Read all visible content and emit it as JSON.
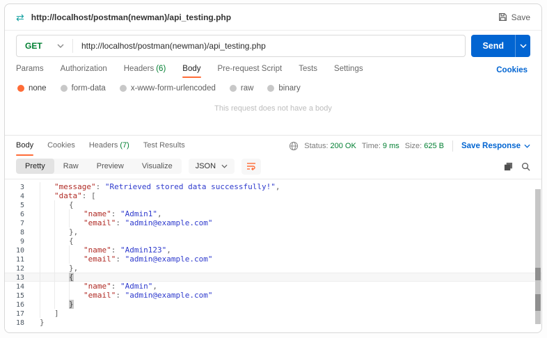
{
  "titlebar": {
    "title": "http://localhost/postman(newman)/api_testing.php",
    "save_label": "Save"
  },
  "request": {
    "method": "GET",
    "url": "http://localhost/postman(newman)/api_testing.php",
    "send_label": "Send",
    "tabs": [
      {
        "label": "Params"
      },
      {
        "label": "Authorization"
      },
      {
        "label": "Headers",
        "count": "(6)"
      },
      {
        "label": "Body",
        "active": true
      },
      {
        "label": "Pre-request Script"
      },
      {
        "label": "Tests"
      },
      {
        "label": "Settings"
      }
    ],
    "cookies_link": "Cookies",
    "body_types": [
      {
        "label": "none",
        "selected": true
      },
      {
        "label": "form-data"
      },
      {
        "label": "x-www-form-urlencoded"
      },
      {
        "label": "raw"
      },
      {
        "label": "binary"
      }
    ],
    "empty_body_message": "This request does not have a body"
  },
  "response": {
    "tabs": [
      {
        "label": "Body",
        "active": true
      },
      {
        "label": "Cookies"
      },
      {
        "label": "Headers",
        "count": "(7)"
      },
      {
        "label": "Test Results"
      }
    ],
    "meta": {
      "status_label": "Status:",
      "status_value": "200 OK",
      "time_label": "Time:",
      "time_value": "9 ms",
      "size_label": "Size:",
      "size_value": "625 B"
    },
    "save_response_label": "Save Response",
    "view_tabs": [
      {
        "label": "Pretty",
        "active": true
      },
      {
        "label": "Raw"
      },
      {
        "label": "Preview"
      },
      {
        "label": "Visualize"
      }
    ],
    "format_select": "JSON",
    "code": {
      "lines": [
        {
          "n": 3,
          "indent": 1,
          "tokens": [
            {
              "c": "key",
              "t": "\"message\""
            },
            {
              "c": "punc",
              "t": ": "
            },
            {
              "c": "str",
              "t": "\"Retrieved stored data successfully!\""
            },
            {
              "c": "punc",
              "t": ","
            }
          ]
        },
        {
          "n": 4,
          "indent": 1,
          "tokens": [
            {
              "c": "key",
              "t": "\"data\""
            },
            {
              "c": "punc",
              "t": ": "
            },
            {
              "c": "punc",
              "t": "["
            }
          ]
        },
        {
          "n": 5,
          "indent": 2,
          "tokens": [
            {
              "c": "punc",
              "t": "{"
            }
          ]
        },
        {
          "n": 6,
          "indent": 3,
          "tokens": [
            {
              "c": "key",
              "t": "\"name\""
            },
            {
              "c": "punc",
              "t": ": "
            },
            {
              "c": "str",
              "t": "\"Admin1\""
            },
            {
              "c": "punc",
              "t": ","
            }
          ]
        },
        {
          "n": 7,
          "indent": 3,
          "tokens": [
            {
              "c": "key",
              "t": "\"email\""
            },
            {
              "c": "punc",
              "t": ": "
            },
            {
              "c": "str",
              "t": "\"admin@example.com\""
            }
          ]
        },
        {
          "n": 8,
          "indent": 2,
          "tokens": [
            {
              "c": "punc",
              "t": "},"
            }
          ]
        },
        {
          "n": 9,
          "indent": 2,
          "tokens": [
            {
              "c": "punc",
              "t": "{"
            }
          ]
        },
        {
          "n": 10,
          "indent": 3,
          "tokens": [
            {
              "c": "key",
              "t": "\"name\""
            },
            {
              "c": "punc",
              "t": ": "
            },
            {
              "c": "str",
              "t": "\"Admin123\""
            },
            {
              "c": "punc",
              "t": ","
            }
          ]
        },
        {
          "n": 11,
          "indent": 3,
          "tokens": [
            {
              "c": "key",
              "t": "\"email\""
            },
            {
              "c": "punc",
              "t": ": "
            },
            {
              "c": "str",
              "t": "\"admin@example.com\""
            }
          ]
        },
        {
          "n": 12,
          "indent": 2,
          "tokens": [
            {
              "c": "punc",
              "t": "},"
            }
          ]
        },
        {
          "n": 13,
          "indent": 2,
          "current": true,
          "tokens": [
            {
              "c": "hl",
              "t": "{"
            }
          ]
        },
        {
          "n": 14,
          "indent": 3,
          "tokens": [
            {
              "c": "key",
              "t": "\"name\""
            },
            {
              "c": "punc",
              "t": ": "
            },
            {
              "c": "str",
              "t": "\"Admin\""
            },
            {
              "c": "punc",
              "t": ","
            }
          ]
        },
        {
          "n": 15,
          "indent": 3,
          "tokens": [
            {
              "c": "key",
              "t": "\"email\""
            },
            {
              "c": "punc",
              "t": ": "
            },
            {
              "c": "str",
              "t": "\"admin@example.com\""
            }
          ]
        },
        {
          "n": 16,
          "indent": 2,
          "tokens": [
            {
              "c": "hl",
              "t": "}"
            }
          ]
        },
        {
          "n": 17,
          "indent": 1,
          "tokens": [
            {
              "c": "punc",
              "t": "]"
            }
          ]
        },
        {
          "n": 18,
          "indent": 0,
          "tokens": [
            {
              "c": "punc",
              "t": "}"
            }
          ]
        }
      ]
    }
  },
  "icons": {
    "request_icon": "⇄",
    "save_icon": "floppy-disk",
    "chevron_down_icon": "chevron-down",
    "globe_icon": "globe",
    "wrap_lines_icon": "wrap-lines",
    "copy_icon": "copy",
    "search_icon": "magnifier"
  },
  "colors": {
    "accent_orange": "#FF6C37",
    "method_green": "#007F31",
    "link_blue": "#0265D2",
    "json_key_red": "#B02B25",
    "json_string_blue": "#2F3BCD"
  }
}
